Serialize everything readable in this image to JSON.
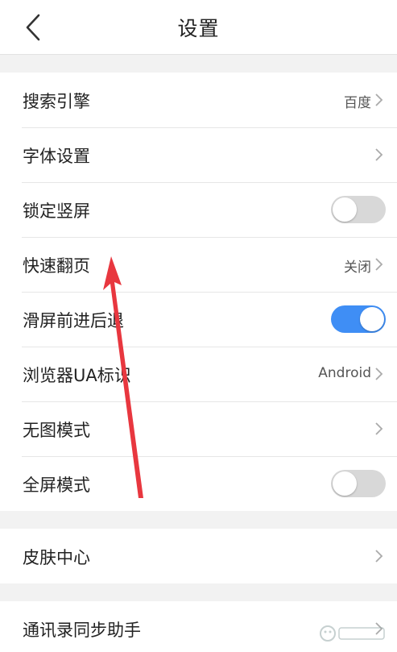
{
  "header": {
    "title": "设置",
    "back_icon": "chevron-left-icon"
  },
  "groups": [
    {
      "rows": [
        {
          "label": "搜索引擎",
          "value": "百度",
          "control": "chevron"
        },
        {
          "label": "字体设置",
          "value": "",
          "control": "chevron"
        },
        {
          "label": "锁定竖屏",
          "control": "toggle",
          "on": false
        },
        {
          "label": "快速翻页",
          "value": "关闭",
          "control": "chevron"
        },
        {
          "label": "滑屏前进后退",
          "control": "toggle",
          "on": true
        },
        {
          "label": "浏览器UA标识",
          "value": "Android",
          "control": "chevron"
        },
        {
          "label": "无图模式",
          "value": "",
          "control": "chevron"
        },
        {
          "label": "全屏模式",
          "control": "toggle",
          "on": false
        }
      ]
    },
    {
      "rows": [
        {
          "label": "皮肤中心",
          "value": "",
          "control": "chevron"
        }
      ]
    },
    {
      "rows": [
        {
          "label": "通讯录同步助手",
          "value": "",
          "control": "chevron"
        }
      ]
    }
  ],
  "colors": {
    "toggle_on": "#3f8ef5",
    "toggle_off": "#d8d8d8",
    "annotation_arrow": "#e8373f"
  },
  "watermark_icon": "baidu-jingyan-watermark-icon"
}
